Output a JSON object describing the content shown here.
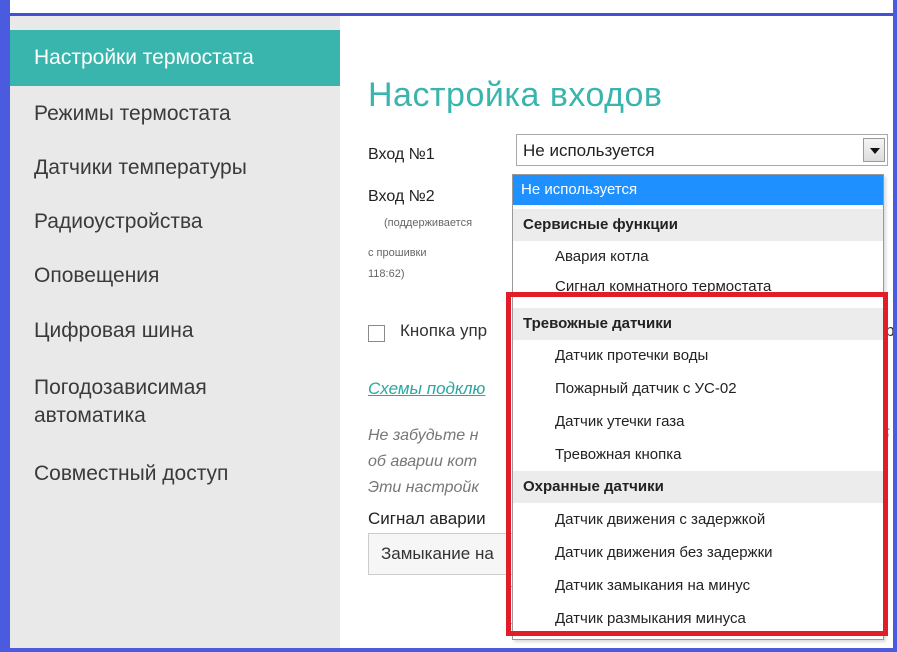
{
  "sidebar": {
    "items": [
      {
        "label": "Настройки термостата",
        "active": true
      },
      {
        "label": "Режимы термостата"
      },
      {
        "label": "Датчики температуры"
      },
      {
        "label": "Радиоустройства"
      },
      {
        "label": "Оповещения"
      },
      {
        "label": "Цифровая шина"
      },
      {
        "label": "Погодозависимая автоматика"
      },
      {
        "label": "Совместный доступ"
      }
    ]
  },
  "main": {
    "title": "Настройка входов",
    "input1_label": "Вход №1",
    "input2_label": "Вход №2",
    "input2_note1": "(поддерживается",
    "input2_note2": "с прошивки",
    "input2_note3": "118:62)",
    "select_value": "Не используется",
    "checkbox_label": "Кнопка упр",
    "checkbox_label_tail": "пр",
    "link_text": "Схемы подклю",
    "note_line1": "Не забудьте н",
    "note_line2": "об аварии кот",
    "note_line3": "Эти настройк",
    "note_tail": "б",
    "alarm_label": "Сигнал аварии",
    "alarm_value": "Замыкание на"
  },
  "dropdown": {
    "items": [
      {
        "type": "selected",
        "label": "Не используется"
      },
      {
        "type": "group",
        "label": "Сервисные функции"
      },
      {
        "type": "option",
        "label": "Авария котла"
      },
      {
        "type": "option",
        "label": "Сигнал комнатного термостата"
      },
      {
        "type": "group",
        "label": "Тревожные датчики"
      },
      {
        "type": "option",
        "label": "Датчик протечки воды"
      },
      {
        "type": "option",
        "label": "Пожарный датчик с УС-02"
      },
      {
        "type": "option",
        "label": "Датчик утечки газа"
      },
      {
        "type": "option",
        "label": "Тревожная кнопка"
      },
      {
        "type": "group",
        "label": "Охранные датчики"
      },
      {
        "type": "option",
        "label": "Датчик движения с задержкой"
      },
      {
        "type": "option",
        "label": "Датчик движения без задержки"
      },
      {
        "type": "option",
        "label": "Датчик замыкания на минус"
      },
      {
        "type": "option",
        "label": "Датчик размыкания минуса"
      }
    ]
  },
  "colors": {
    "accent": "#3ab5ad",
    "selection": "#1e90ff",
    "highlight": "#e11d2a",
    "frame": "#4a5be0"
  }
}
